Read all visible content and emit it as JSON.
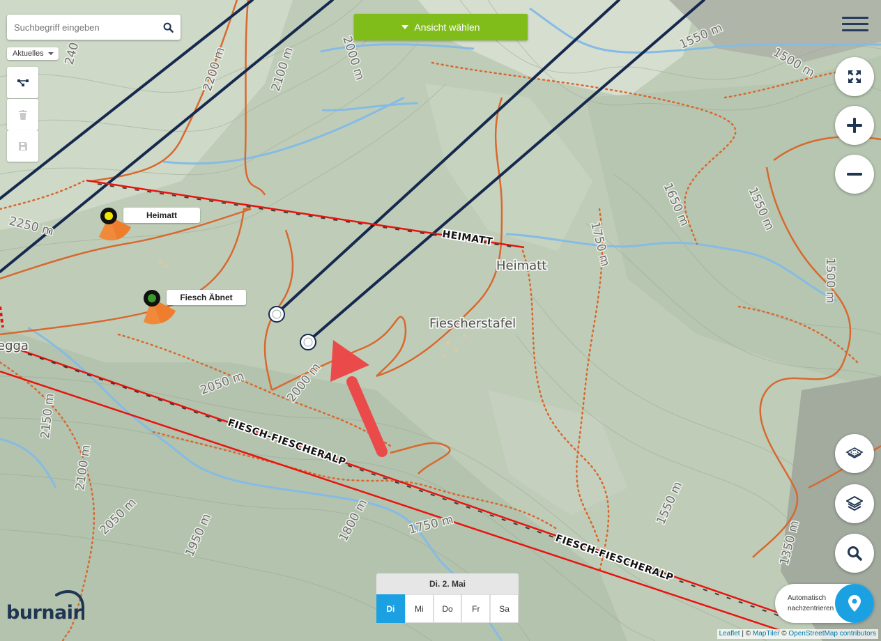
{
  "search": {
    "placeholder": "Suchbegriff eingeben"
  },
  "filter": {
    "selected": "Aktuelles"
  },
  "tools": {
    "icons": [
      "network-icon",
      "trash-icon",
      "save-icon"
    ]
  },
  "view_selector": {
    "label": "Ansicht wählen"
  },
  "map": {
    "contour_labels": [
      "240",
      "2200 m",
      "2100 m",
      "2000 m",
      "1550 m",
      "1500 m",
      "2250 m",
      "1650 m",
      "1550 m",
      "1750 m",
      "1500 m",
      "2150 m",
      "2050 m",
      "2000 m",
      "2100 m",
      "2050 m",
      "1950 m",
      "1800 m",
      "1750 m",
      "1550 m",
      "1350 m"
    ],
    "place_names": [
      "Heimatt",
      "Fiescherstafel",
      "egga"
    ],
    "cable_lines": [
      "HEIMATT",
      "FIESCH-FIESCHERALP",
      "FIESCH-FIESCHERALP"
    ],
    "stations": [
      {
        "name": "Heimatt",
        "status_color": "#f2e600"
      },
      {
        "name": "Fiesch Äbnet",
        "status_color": "#3a9a2a"
      }
    ],
    "colors": {
      "flight_line": "#16294e",
      "cable": "#e8130f",
      "path": "#d8682e",
      "stream": "#7fb6e0",
      "arrow": "#ea4a4a"
    }
  },
  "controls": {
    "fullscreen_icon": "fullscreen-icon",
    "zoom_in_icon": "plus-icon",
    "zoom_out_icon": "minus-icon",
    "layer_icon": "layers-outline-icon",
    "layers_icon": "layers-icon",
    "search_icon": "search-icon",
    "recenter_label": "Automatisch nachzentrieren"
  },
  "days": {
    "header": "Di. 2. Mai",
    "tabs": [
      "Di",
      "Mi",
      "Do",
      "Fr",
      "Sa"
    ],
    "active": "Di"
  },
  "attribution": {
    "leaflet": "Leaflet",
    "sep": " | © ",
    "maptiler": "MapTiler",
    "mid": " © ",
    "osm": "OpenStreetMap contributors"
  },
  "logo": {
    "text": "burnair"
  }
}
